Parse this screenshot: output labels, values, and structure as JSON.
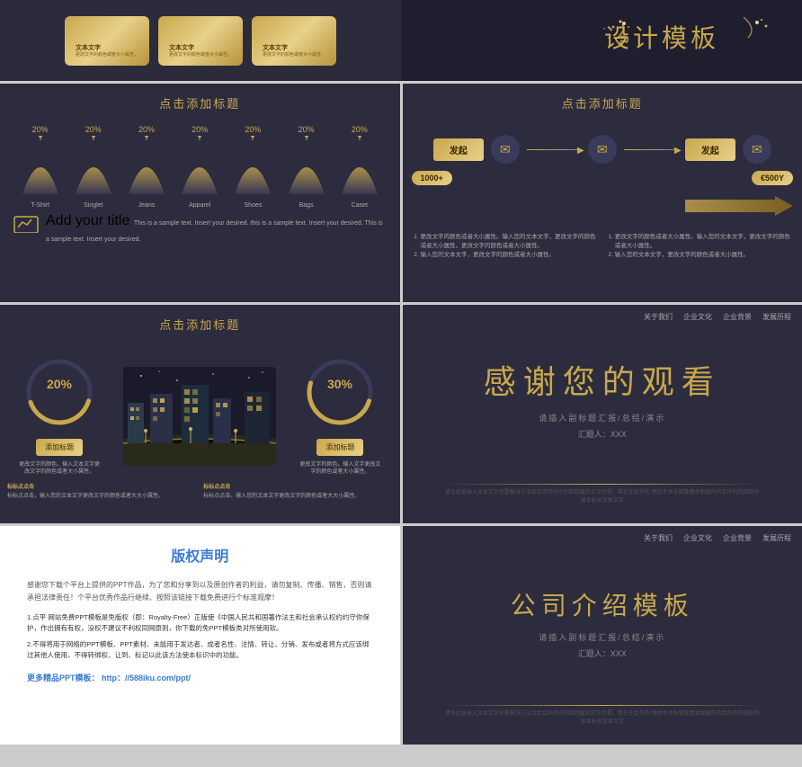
{
  "grid": {
    "top_right_title": "设计模板",
    "gold_sparkle": "✦"
  },
  "cards": [
    {
      "title": "文本文字",
      "text": "更改文字的颜色或者大小属性。"
    },
    {
      "title": "文本文字",
      "text": "更改文字的颜色或者大小属性。"
    },
    {
      "title": "文本文字",
      "text": "更改文字的颜色或者大小属性。"
    }
  ],
  "slide2_1": {
    "title": "点击添加标题",
    "percentages": [
      "20%",
      "20%",
      "20%",
      "20%",
      "20%",
      "20%",
      "20%"
    ],
    "labels": [
      "T-Shirt",
      "Singlet",
      "Jeans",
      "Apparel",
      "Shoes",
      "Bags",
      "Caset"
    ],
    "highlight": "Add your title",
    "body_text": "This is a sample text. Insert your desired. this is a sample text. Insert your desired. This is a sample text. Insert your desired."
  },
  "slide2_2": {
    "title": "点击添加标题",
    "btn1": "发起",
    "btn2": "发起",
    "num1": "1000+",
    "num2": "€500Y",
    "text_left": "1. 更改文字的颜色或者大小属性。输入您的文本文字，更改文字的颜色或者大小属性，更改文字的颜色或者大小属性。\n2. 输入您的文本文字，更改文字的颜色或者大小属性。",
    "text_right": "1. 更改文字的颜色或者大小属性。输入您的文本文字，更改文字的颜色或者大小属性。\n2. 输入您的文本文字，更改文字的颜色或者大小属性。"
  },
  "slide3_1": {
    "title": "点击添加标题",
    "pct_left": "20%",
    "pct_right": "30%",
    "btn_left": "添加标题",
    "btn_right": "添加标题",
    "text_left_top": "更改文字的颜色。输入文本文字更改文字的颜色或者大小属性。",
    "text_right_top": "更改文字的颜色。输入文字更改文字的颜色或者大小属性。",
    "text_left_bottom": "标标点点击，输入您的文本文字更改文字的颜色或者大大小属性。",
    "text_right_bottom": "标标点点击，输入您的文本文字更改文字的颜色或者大大小属性。"
  },
  "slide3_2": {
    "nav": [
      "关于我们",
      "企业文化",
      "企业背景",
      "发展历程"
    ],
    "main_title": "感谢您的观看",
    "subtitle": "请插入副标题汇报/总结/演示",
    "author": "汇题人：XXX",
    "footer": "请在此处插入文本文字也是解决方法合合合作的守则和制度的文字也是。希在在合作的\n然后不关系制度基本制度作的合作的完成的作该本标识文本文字"
  },
  "slide4_1": {
    "title": "版权声明",
    "intro": "感谢您下载个平台上提供的PPT作品，为了您和分享到以及原创作者的利益，请勿复制、传播、销售，否则请承担法律责任！个平台优秀作品行继续、按照该链接下载免费进行个标准观摩！",
    "point1": "1.点平 网站免费PPT模板是免版权（即：Royalty-Free）正版使《中国人民共和国著作法主和社会承认权约约守你保护，作出拥有有权，没权不建议不利权同网原则，你下载的免PPT模板类对所使用软。",
    "point2": "2.不得将用于网络的PPT模板、PPT素材、未能用于发达者、成者名性、注情、转让、分销、发布或者将方式应该绑过其他人使用，不得转绑权、让到、标记以此该方法使本标识中的功能。",
    "link_label": "更多精品PPT模板：",
    "link": "http：//588iku.com/ppt/"
  },
  "slide4_2": {
    "nav": [
      "关于我们",
      "企业文化",
      "企业背景",
      "发展历程"
    ],
    "main_title": "公司介绍模板",
    "subtitle": "请插入副标题汇报/总结/演示",
    "author": "汇题人：XXX",
    "footer": "请在此处插入文本文字也是解决方法合合合作的守则和制度的文字也是。希在在合作的\n然后不关系制度基本制度作的合作的完成的作该本标识文本文字"
  }
}
